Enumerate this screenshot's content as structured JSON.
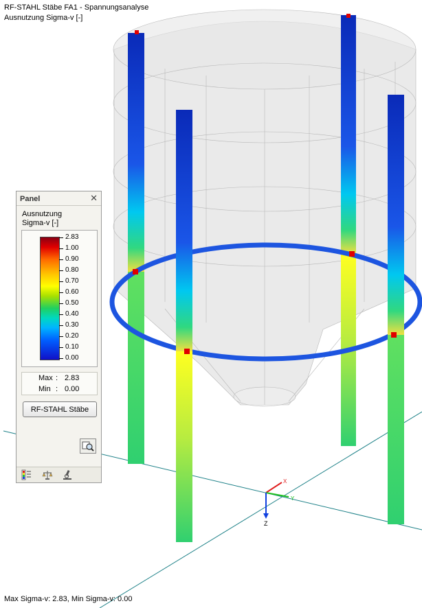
{
  "title": "RF-STAHL Stäbe FA1 - Spannungsanalyse",
  "subtitle": "Ausnutzung Sigma-v [-]",
  "status": "Max Sigma-v: 2.83, Min Sigma-v: 0.00",
  "panel": {
    "title": "Panel",
    "close_glyph": "✕",
    "legend_heading_line1": "Ausnutzung",
    "legend_heading_line2": "Sigma-v [-]",
    "scale_ticks": [
      "2.83",
      "1.00",
      "0.90",
      "0.80",
      "0.70",
      "0.60",
      "0.50",
      "0.40",
      "0.30",
      "0.20",
      "0.10",
      "0.00"
    ],
    "max_label": "Max",
    "max_sep": ":",
    "max_value": "2.83",
    "min_label": "Min",
    "min_sep": ":",
    "min_value": "0.00",
    "button_label": "RF-STAHL Stäbe",
    "tab_icons": [
      "color-scale-icon",
      "balance-icon",
      "microscope-icon"
    ]
  },
  "axes": {
    "x": "X",
    "y": "Y",
    "z": "Z"
  },
  "colors": {
    "low": "#1010c8",
    "mid": "#20d060",
    "high": "#ffff00",
    "max": "#e00000",
    "ground_line": "#1a7f86"
  }
}
